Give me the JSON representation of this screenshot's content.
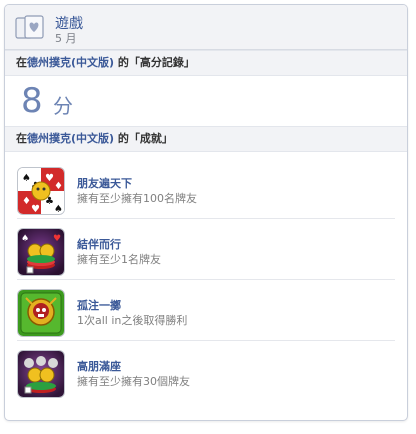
{
  "header": {
    "title": "遊戲",
    "date": "5 月"
  },
  "high_score_section": {
    "prefix": "在",
    "game_name": "德州撲克(中文版)",
    "suffix": "的「高分記錄」"
  },
  "score": {
    "value": "8",
    "unit": "分"
  },
  "achievements_section": {
    "prefix": "在",
    "game_name": "德州撲克(中文版)",
    "suffix": "的「成就」"
  },
  "achievements": [
    {
      "title": "朋友遍天下",
      "description": "擁有至少擁有100名牌友",
      "icon": "cards-friends-icon"
    },
    {
      "title": "結伴而行",
      "description": "擁有至少1名牌友",
      "icon": "poker-chips-icon"
    },
    {
      "title": "孤注一擲",
      "description": "1次all in之後取得勝利",
      "icon": "green-skull-icon"
    },
    {
      "title": "高朋滿座",
      "description": "擁有至少擁有30個牌友",
      "icon": "crowd-chips-icon"
    }
  ]
}
